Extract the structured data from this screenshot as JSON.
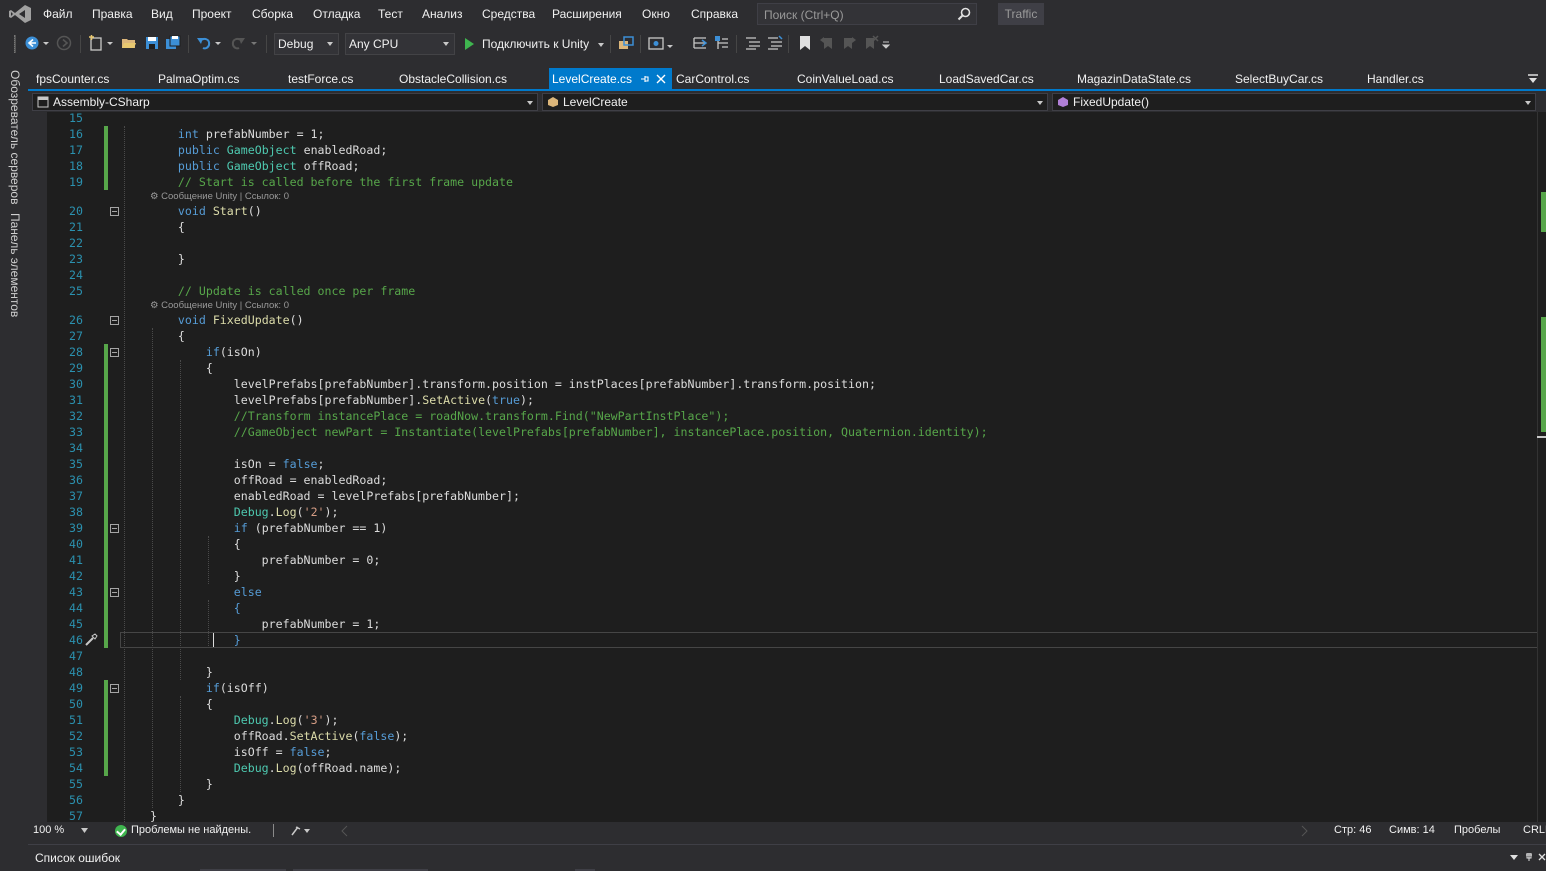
{
  "menu": {
    "items": [
      "Файл",
      "Правка",
      "Вид",
      "Проект",
      "Сборка",
      "Отладка",
      "Тест",
      "Анализ",
      "Средства",
      "Расширения",
      "Окно",
      "Справка"
    ],
    "search_placeholder": "Поиск (Ctrl+Q)",
    "traffic": "Traffic"
  },
  "toolbar": {
    "configuration": "Debug",
    "platform": "Any CPU",
    "run_label": "Подключить к Unity"
  },
  "side_panel": {
    "server_explorer": "Обозреватель серверов",
    "toolbox": "Панель элементов"
  },
  "tabs": [
    {
      "label": "fpsCounter.cs",
      "active": false
    },
    {
      "label": "PalmaOptim.cs",
      "active": false
    },
    {
      "label": "testForce.cs",
      "active": false
    },
    {
      "label": "ObstacleCollision.cs",
      "active": false
    },
    {
      "label": "LevelCreate.cs",
      "active": true
    },
    {
      "label": "CarControl.cs",
      "active": false
    },
    {
      "label": "CoinValueLoad.cs",
      "active": false
    },
    {
      "label": "LoadSavedCar.cs",
      "active": false
    },
    {
      "label": "MagazinDataState.cs",
      "active": false
    },
    {
      "label": "SelectBuyCar.cs",
      "active": false
    },
    {
      "label": "Handler.cs",
      "active": false
    }
  ],
  "navbar": {
    "project": "Assembly-CSharp",
    "class": "LevelCreate",
    "member": "FixedUpdate()"
  },
  "editor": {
    "code_lens": "Сообщение Unity | Ссылок: 0",
    "lines": [
      {
        "n": "15",
        "html": ""
      },
      {
        "n": "16",
        "html": "    <span class=\"k\">int</span> prefabNumber = 1;"
      },
      {
        "n": "17",
        "html": "    <span class=\"k\">public</span> <span class=\"t\">GameObject</span> enabledRoad;"
      },
      {
        "n": "18",
        "html": "    <span class=\"k\">public</span> <span class=\"t\">GameObject</span> offRoad;"
      },
      {
        "n": "19",
        "html": "    <span class=\"c\">// Start is called before the first frame update</span>"
      },
      {
        "n": "20",
        "html": "    <span class=\"k\">void</span> <span class=\"m\">Start</span>()"
      },
      {
        "n": "21",
        "html": "    {"
      },
      {
        "n": "22",
        "html": ""
      },
      {
        "n": "23",
        "html": "    }"
      },
      {
        "n": "24",
        "html": ""
      },
      {
        "n": "25",
        "html": "    <span class=\"c\">// Update is called once per frame</span>"
      },
      {
        "n": "26",
        "html": "    <span class=\"k\">void</span> <span class=\"m\">FixedUpdate</span>()"
      },
      {
        "n": "27",
        "html": "    {"
      },
      {
        "n": "28",
        "html": "        <span class=\"k\">if</span>(isOn)"
      },
      {
        "n": "29",
        "html": "        {"
      },
      {
        "n": "30",
        "html": "            levelPrefabs[prefabNumber].transform.position = instPlaces[prefabNumber].transform.position;"
      },
      {
        "n": "31",
        "html": "            levelPrefabs[prefabNumber].<span class=\"m\">SetActive</span>(<span class=\"k\">true</span>);"
      },
      {
        "n": "32",
        "html": "            <span class=\"c\">//Transform instancePlace = roadNow.transform.Find(\"NewPartInstPlace\");</span>"
      },
      {
        "n": "33",
        "html": "            <span class=\"c\">//GameObject newPart = Instantiate(levelPrefabs[prefabNumber], instancePlace.position, Quaternion.identity);</span>"
      },
      {
        "n": "34",
        "html": ""
      },
      {
        "n": "35",
        "html": "            isOn = <span class=\"k\">false</span>;"
      },
      {
        "n": "36",
        "html": "            offRoad = enabledRoad;"
      },
      {
        "n": "37",
        "html": "            enabledRoad = levelPrefabs[prefabNumber];"
      },
      {
        "n": "38",
        "html": "            <span class=\"t\">Debug</span>.<span class=\"m\">Log</span>(<span class=\"s\">'2'</span>);"
      },
      {
        "n": "39",
        "html": "            <span class=\"k\">if</span> (prefabNumber == 1)"
      },
      {
        "n": "40",
        "html": "            {"
      },
      {
        "n": "41",
        "html": "                prefabNumber = 0;"
      },
      {
        "n": "42",
        "html": "            }"
      },
      {
        "n": "43",
        "html": "            <span class=\"k\">else</span>"
      },
      {
        "n": "44",
        "html": "            <span class=\"k\">{</span>"
      },
      {
        "n": "45",
        "html": "                prefabNumber = 1;"
      },
      {
        "n": "46",
        "html": "            <span class=\"k\">}</span>"
      },
      {
        "n": "47",
        "html": ""
      },
      {
        "n": "48",
        "html": "        }"
      },
      {
        "n": "49",
        "html": "        <span class=\"k\">if</span>(isOff)"
      },
      {
        "n": "50",
        "html": "        {"
      },
      {
        "n": "51",
        "html": "            <span class=\"t\">Debug</span>.<span class=\"m\">Log</span>(<span class=\"s\">'3'</span>);"
      },
      {
        "n": "52",
        "html": "            offRoad.<span class=\"m\">SetActive</span>(<span class=\"k\">false</span>);"
      },
      {
        "n": "53",
        "html": "            isOff = <span class=\"k\">false</span>;"
      },
      {
        "n": "54",
        "html": "            <span class=\"t\">Debug</span>.<span class=\"m\">Log</span>(offRoad.name);"
      },
      {
        "n": "55",
        "html": "        }"
      },
      {
        "n": "56",
        "html": "    }"
      },
      {
        "n": "57",
        "html": "}"
      }
    ]
  },
  "status": {
    "zoom": "100 %",
    "problems": "Проблемы не найдены.",
    "line": "Стр: 46",
    "char": "Симв: 14",
    "spaces": "Пробелы",
    "eol": "CRLF"
  },
  "error_list": {
    "title": "Список ошибок"
  },
  "colors": {
    "accent": "#007acc",
    "background": "#1e1e1e",
    "chrome": "#2d2d30",
    "keyword": "#569cd6",
    "type": "#4ec9b0",
    "comment": "#57a64a",
    "string": "#d69d85",
    "line_number": "#2b91af",
    "change_marker": "#57a64a"
  }
}
